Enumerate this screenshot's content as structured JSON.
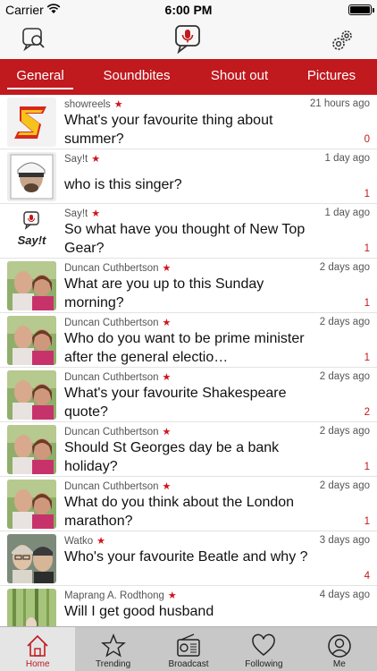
{
  "status_bar": {
    "carrier": "Carrier",
    "time": "6:00 PM"
  },
  "tabs": [
    "General",
    "Soundbites",
    "Shout out",
    "Pictures"
  ],
  "feed": [
    {
      "author": "showreels",
      "time": "21 hours ago",
      "question": "What's your favourite thing about summer?",
      "count": "0",
      "avatar": "showreels-logo"
    },
    {
      "author": "Say!t",
      "time": "1 day ago",
      "question": "who is this singer?",
      "count": "1",
      "avatar": "singer-photo"
    },
    {
      "author": "Say!t",
      "time": "1 day ago",
      "question": "So what have you thought of New Top Gear?",
      "count": "1",
      "avatar": "sayit-logo"
    },
    {
      "author": "Duncan Cuthbertson",
      "time": "2 days ago",
      "question": "What are you up to this Sunday morning?",
      "count": "1",
      "avatar": "couple-photo"
    },
    {
      "author": "Duncan Cuthbertson",
      "time": "2 days ago",
      "question": "Who do you want to be prime minister after the general electio…",
      "count": "1",
      "avatar": "couple-photo"
    },
    {
      "author": "Duncan Cuthbertson",
      "time": "2 days ago",
      "question": "What's your favourite Shakespeare quote?",
      "count": "2",
      "avatar": "couple-photo"
    },
    {
      "author": "Duncan Cuthbertson",
      "time": "2 days ago",
      "question": "Should St Georges day be a bank holiday?",
      "count": "1",
      "avatar": "couple-photo"
    },
    {
      "author": "Duncan Cuthbertson",
      "time": "2 days ago",
      "question": "What do you think about the London marathon?",
      "count": "1",
      "avatar": "couple-photo"
    },
    {
      "author": "Watko",
      "time": "3 days ago",
      "question": "Who's your favourite Beatle and why ?",
      "count": "4",
      "avatar": "watko-photo"
    },
    {
      "author": "Maprang A. Rodthong",
      "time": "4 days ago",
      "question": "Will I get good husband",
      "count": "",
      "avatar": "bamboo-photo"
    }
  ],
  "bottom_tabs": [
    "Home",
    "Trending",
    "Broadcast",
    "Following",
    "Me"
  ],
  "logo_text": "Say!t",
  "colors": {
    "accent": "#c0191e"
  }
}
